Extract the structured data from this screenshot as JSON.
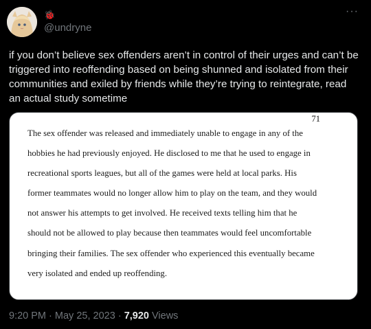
{
  "tweet": {
    "author_emoji": "🐞",
    "handle": "@undryne",
    "more_label": "···",
    "text": "if you don’t believe sex offenders aren’t in control of their urges and can’t be triggered into reoffending based on being shunned and isolated from their communities and exiled by friends while they’re trying to reintegrate, read an actual study sometime",
    "media": {
      "page_number": "71",
      "lines": [
        "The sex offender was released and immediately unable to engage in any of the",
        "hobbies he had previously enjoyed. He disclosed to me that he used to engage in",
        "recreational sports leagues, but all of the games were held at local parks. His",
        "former teammates would no longer allow him to play on the team, and they would",
        "not answer his attempts to get involved. He received texts telling him that he",
        "should not be allowed to play because then teammates would feel uncomfortable",
        "bringing their families. The sex offender who experienced this eventually became",
        "very isolated and ended up reoffending."
      ]
    },
    "time": "9:20 PM",
    "date": "May 25, 2023",
    "separator": "·",
    "views_count": "7,920",
    "views_label": "Views"
  }
}
